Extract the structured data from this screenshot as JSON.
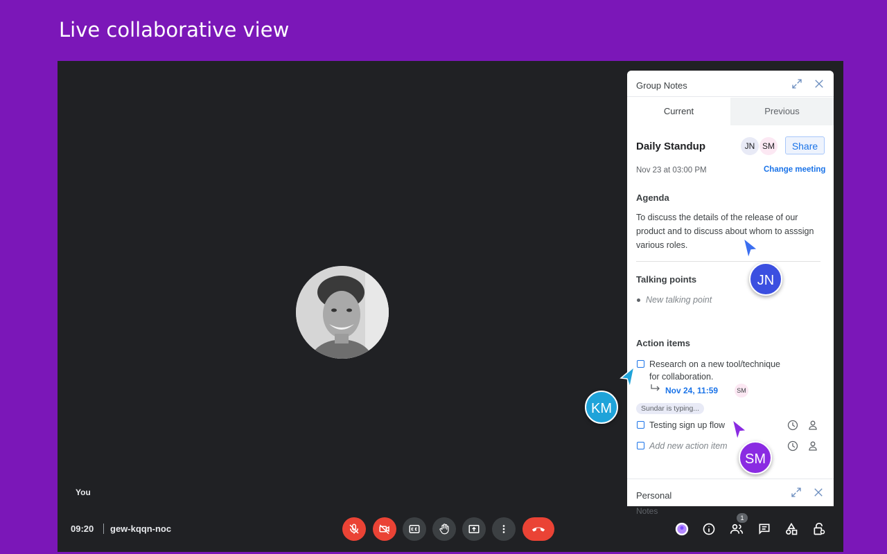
{
  "page": {
    "heading": "Live collaborative view"
  },
  "call": {
    "you_label": "You",
    "time": "09:20",
    "meeting_code": "gew-kqqn-noc",
    "participants_count": "1"
  },
  "notes": {
    "title": "Group Notes",
    "tabs": {
      "current": "Current",
      "previous": "Previous"
    },
    "meeting_title": "Daily Standup",
    "avatars": [
      {
        "initials": "JN",
        "color": "#e8eaf6"
      },
      {
        "initials": "SM",
        "color": "#fce8f3"
      }
    ],
    "share_label": "Share",
    "date": "Nov 23 at 03:00 PM",
    "change_meeting": "Change meeting",
    "agenda_heading": "Agenda",
    "agenda_text": "To discuss the details of the release of our product and to discuss about whom to asssign various roles.",
    "talking_points_heading": "Talking points",
    "talking_point_placeholder": "New talking point",
    "action_items_heading": "Action items",
    "action_items": [
      {
        "line1": "Research on a new tool/technique",
        "line2": "for collaboration.",
        "due": "Nov 24, 11:59",
        "assignee": "SM"
      },
      {
        "text": "Testing sign up flow"
      }
    ],
    "typing_indicator": "Sundar is typing...",
    "new_action_placeholder": "Add new action item",
    "personal_title": "Personal",
    "personal_notes": "Notes"
  },
  "collaborators": [
    {
      "initials": "JN",
      "color": "#3b4fe0"
    },
    {
      "initials": "KM",
      "color": "#1fa3d9"
    },
    {
      "initials": "SM",
      "color": "#8a2be2"
    }
  ]
}
